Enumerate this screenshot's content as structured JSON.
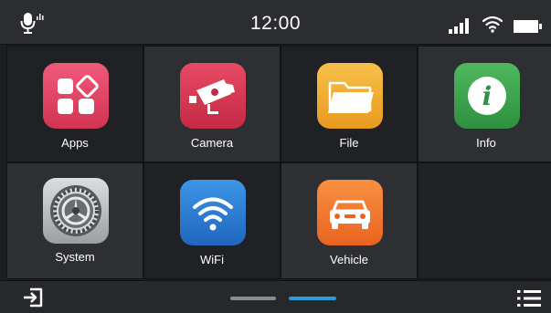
{
  "status": {
    "time": "12:00",
    "mic_icon": "voice-mic-icon",
    "signal_icon": "cell-signal-icon",
    "wifi_icon": "wifi-status-icon",
    "battery_icon": "battery-icon"
  },
  "apps": [
    {
      "id": "apps",
      "label": "Apps",
      "icon": "apps-icon",
      "color": "#e0405f"
    },
    {
      "id": "camera",
      "label": "Camera",
      "icon": "camera-icon",
      "color": "#d2364f"
    },
    {
      "id": "file",
      "label": "File",
      "icon": "folder-icon",
      "color": "#f0a92c"
    },
    {
      "id": "info",
      "label": "Info",
      "icon": "info-icon",
      "color": "#3da34a"
    },
    {
      "id": "system",
      "label": "System",
      "icon": "gear-icon",
      "color": "#b8b9bb"
    },
    {
      "id": "wifi",
      "label": "WiFi",
      "icon": "wifi-icon",
      "color": "#2b7fd6"
    },
    {
      "id": "vehicle",
      "label": "Vehicle",
      "icon": "car-icon",
      "color": "#f0772a"
    }
  ],
  "bottom": {
    "exit_icon": "exit-icon",
    "menu_icon": "menu-list-icon",
    "pages": 2,
    "active_page": 2,
    "indicator_colors": {
      "inactive": "#8a8c8f",
      "active": "#2a9ad8"
    }
  }
}
